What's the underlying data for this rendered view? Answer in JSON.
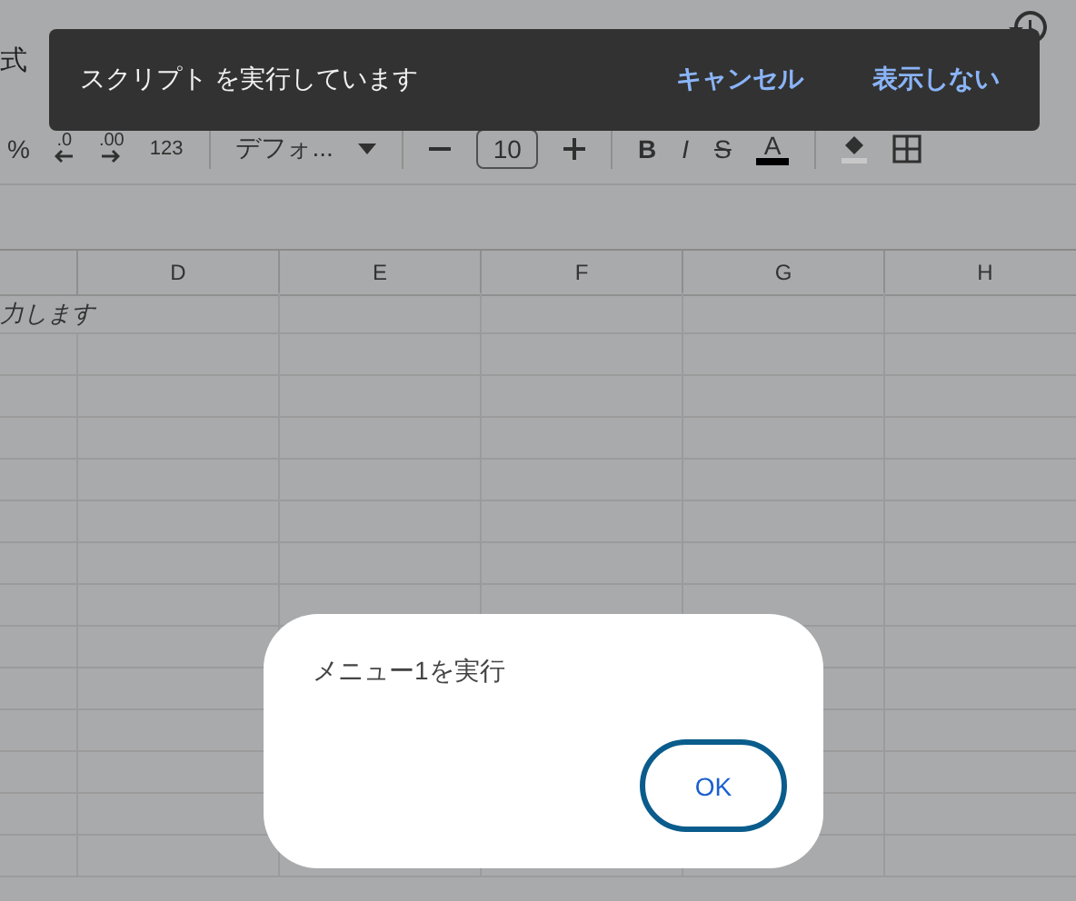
{
  "menu": {
    "label": "式"
  },
  "toolbar": {
    "percent": "%",
    "decrease_decimal": ".0",
    "increase_decimal": ".00",
    "number_format": "123",
    "font": "デフォ...",
    "font_size": "10",
    "bold": "B",
    "italic": "I",
    "strikethrough": "S",
    "text_color": "A"
  },
  "sheet": {
    "columns": [
      "D",
      "E",
      "F",
      "G",
      "H"
    ],
    "overflow_text": "力します"
  },
  "toast": {
    "message": "スクリプト を実行しています",
    "actions": [
      "キャンセル",
      "表示しない"
    ]
  },
  "dialog": {
    "message": "メニュー1を実行",
    "button": "OK"
  }
}
